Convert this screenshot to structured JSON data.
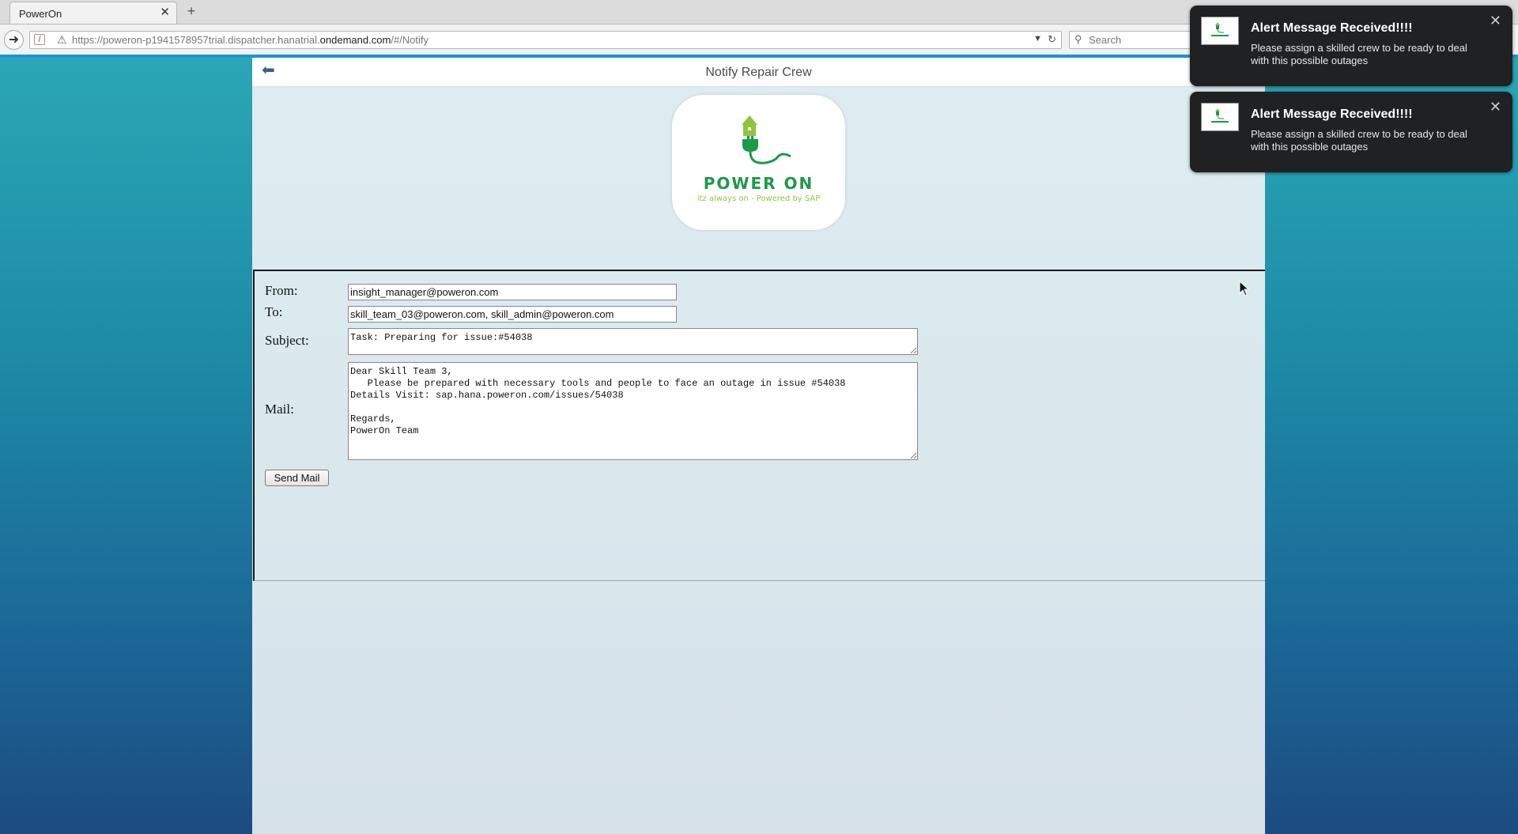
{
  "browser": {
    "tab_title": "PowerOn",
    "url_prefix": "https://poweron-p1941578957trial.dispatcher.hanatrial.",
    "url_domain": "ondemand.com",
    "url_suffix": "/#/Notify",
    "search_placeholder": "Search",
    "icons": [
      "back-icon",
      "shield-icon",
      "warning-icon",
      "dropdown-icon",
      "reload-icon",
      "search-icon",
      "new-tab-icon"
    ]
  },
  "header": {
    "title": "Notify Repair Crew"
  },
  "logo": {
    "name": "POWER ON",
    "tagline": "itz always on - Powered by SAP"
  },
  "form": {
    "from_label": "From:",
    "from_value": "insight_manager@poweron.com",
    "to_label": "To:",
    "to_value": "skill_team_03@poweron.com, skill_admin@poweron.com",
    "subject_label": "Subject:",
    "subject_value": "Task: Preparing for issue:#54038",
    "mail_label": "Mail:",
    "mail_value": "Dear Skill Team 3,\n   Please be prepared with necessary tools and people to face an outage in issue #54038\nDetails Visit: sap.hana.poweron.com/issues/54038\n\nRegards,\nPowerOn Team",
    "send_label": "Send Mail"
  },
  "notifications": [
    {
      "title": "Alert Message Received!!!!",
      "body": "Please assign a skilled crew to be ready to deal with this possible outages"
    },
    {
      "title": "Alert Message Received!!!!",
      "body": "Please assign a skilled crew to be ready to deal with this possible outages"
    }
  ],
  "colors": {
    "accent": "#1995d4",
    "brand_green": "#1a9a4a",
    "brand_lime": "#8cc63f",
    "notification_bg": "#1f2123"
  }
}
